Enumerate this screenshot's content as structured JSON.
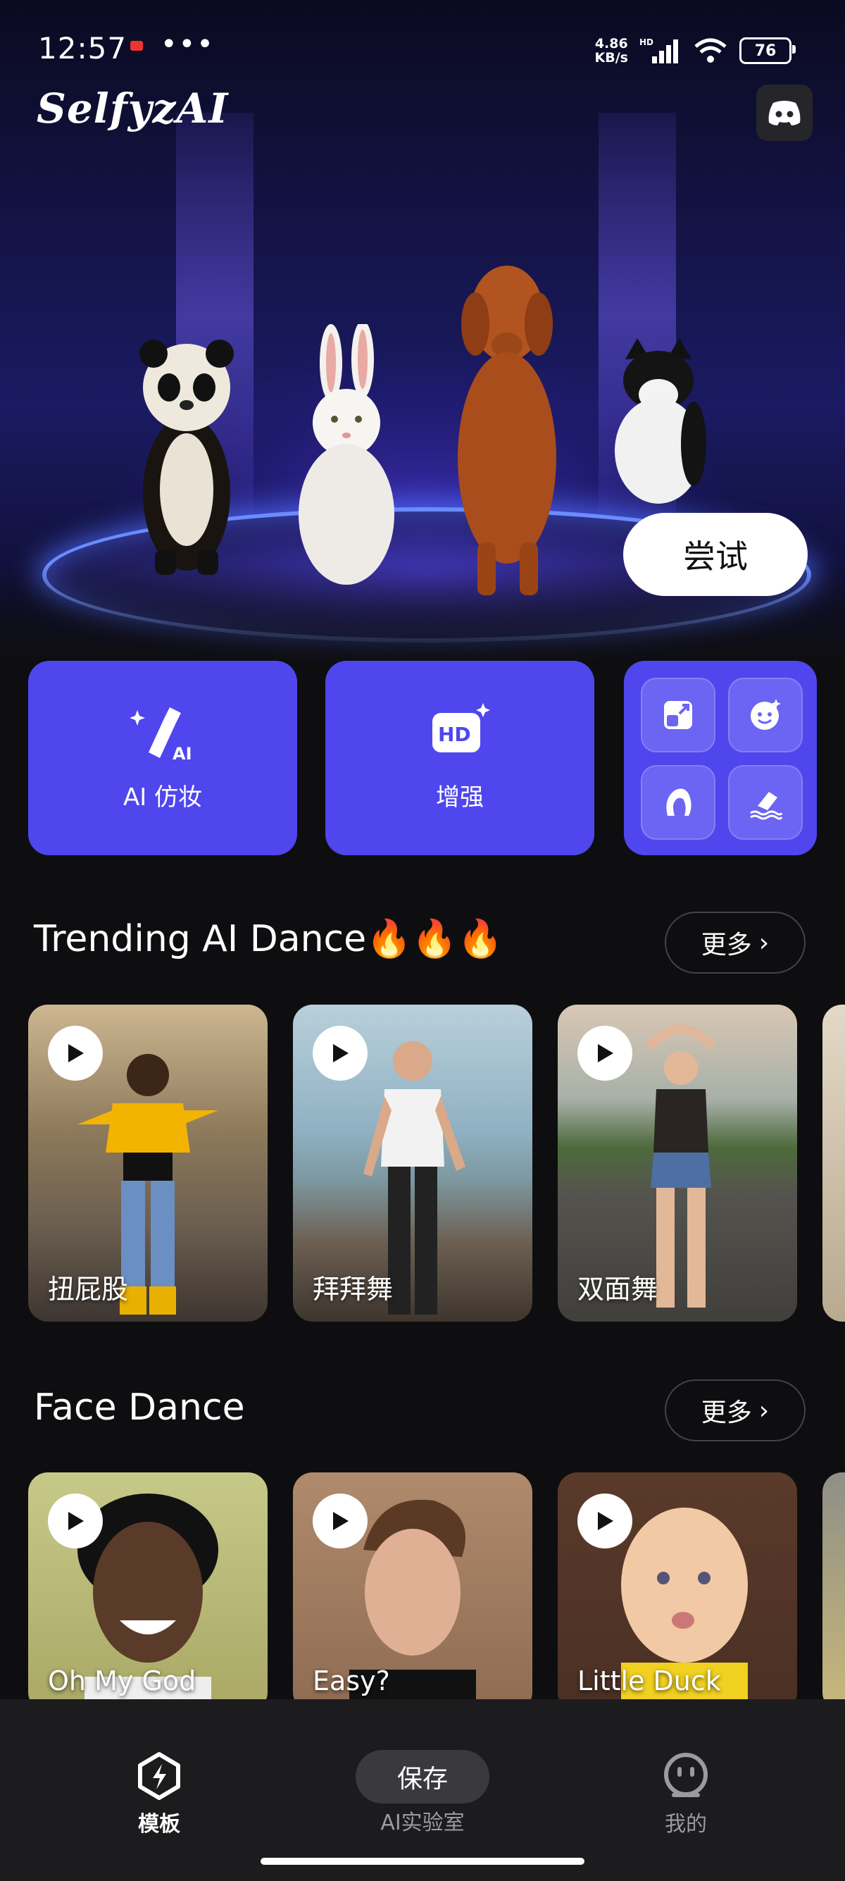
{
  "status_bar": {
    "time": "12:57",
    "dots": "•••",
    "speed_value": "4.86",
    "speed_unit": "KB/s",
    "hd": "HD",
    "battery": "76"
  },
  "app": {
    "logo": "SelfyzAI",
    "try_button": "尝试"
  },
  "features": {
    "makeup_label": "AI 仿妆",
    "enhance_label": "增强",
    "hd_badge": "HD",
    "ai_badge": "AI"
  },
  "trending": {
    "title": "Trending AI Dance🔥🔥🔥",
    "more": "更多",
    "items": [
      {
        "label": "扭屁股"
      },
      {
        "label": "拜拜舞"
      },
      {
        "label": "双面舞"
      }
    ]
  },
  "face_dance": {
    "title": "Face Dance",
    "more": "更多",
    "items": [
      {
        "label": "Oh My God"
      },
      {
        "label": "Easy?"
      },
      {
        "label": "Little Duck"
      }
    ]
  },
  "bottom_nav": {
    "templates": "模板",
    "save": "保存",
    "lab": "AI实验室",
    "mine": "我的"
  },
  "colors": {
    "accent": "#4f46ee",
    "background": "#0e0e10",
    "nav_bg": "#1c1c1e"
  }
}
